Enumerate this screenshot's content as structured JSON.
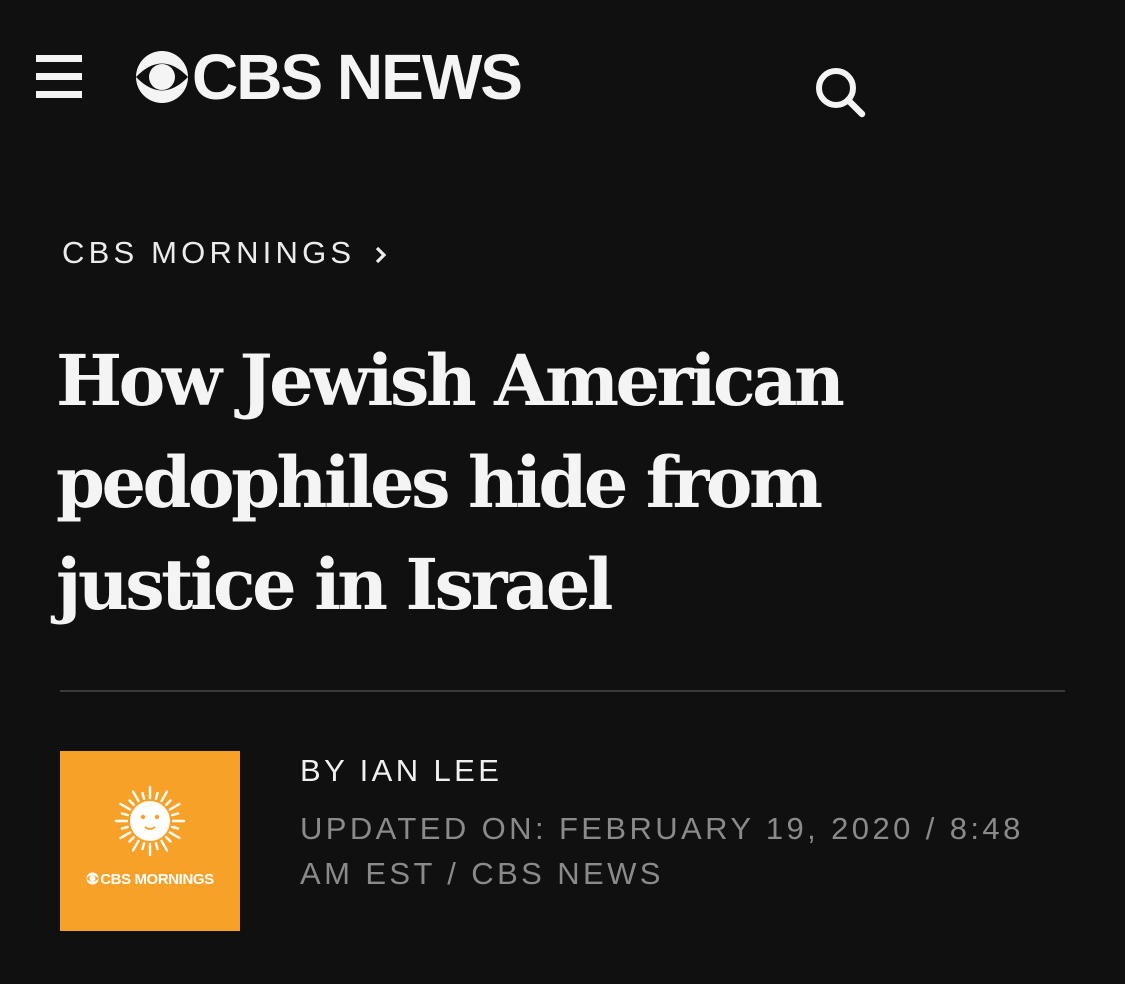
{
  "header": {
    "menu_icon": "hamburger-menu-icon",
    "logo_text": "CBS NEWS",
    "logo_icon": "cbs-eye-icon",
    "search_icon": "search-icon"
  },
  "breadcrumb": {
    "label": "CBS MORNINGS",
    "icon": "chevron-right-icon"
  },
  "article": {
    "headline": "How Jewish American pedophiles hide from justice in Israel",
    "byline": "BY IAN LEE",
    "updated": "UPDATED ON: FEBRUARY 19, 2020 / 8:48 AM EST / CBS NEWS"
  },
  "show": {
    "thumbnail_label": "CBS MORNINGS",
    "thumbnail_icon": "cbs-mornings-sun-icon"
  },
  "colors": {
    "background": "#101010",
    "text": "#f4f4f4",
    "meta_text": "#8a8a8a",
    "divider": "#3a3a3a",
    "brand_orange": "#f7a128"
  }
}
